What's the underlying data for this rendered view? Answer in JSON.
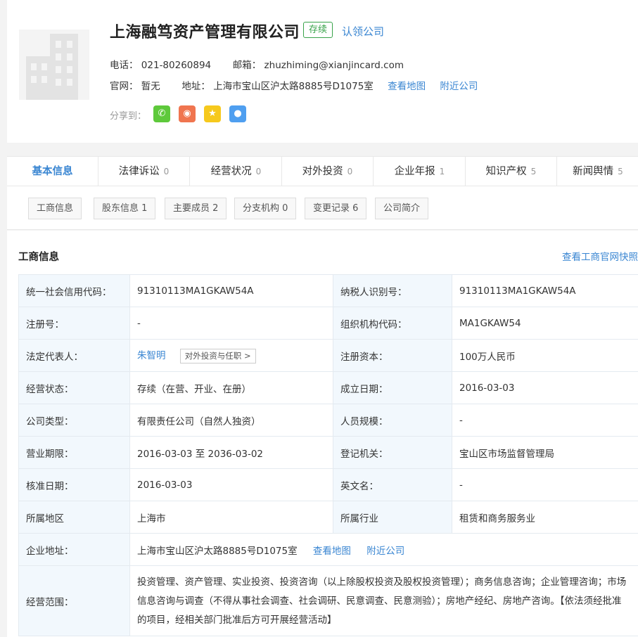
{
  "company": {
    "name": "上海融笃资产管理有限公司",
    "status": "存续",
    "claim": "认领公司",
    "phone_label": "电话：",
    "phone": "021-80260894",
    "email_label": "邮箱：",
    "email": "zhuzhiming@xianjincard.com",
    "website_label": "官网：",
    "website": "暂无",
    "address_label": "地址：",
    "address": "上海市宝山区沪太路8885号D1075室",
    "view_map": "查看地图",
    "nearby": "附近公司",
    "share_label": "分享到："
  },
  "share": [
    {
      "icon": "wechat-icon",
      "glyph": "✆",
      "color": "#5ec93b"
    },
    {
      "icon": "weibo-icon",
      "glyph": "◉",
      "color": "#f0754f"
    },
    {
      "icon": "qzone-icon",
      "glyph": "★",
      "color": "#f6c91d"
    },
    {
      "icon": "qq-icon",
      "glyph": "●",
      "color": "#4f9ff0"
    }
  ],
  "tabs": [
    {
      "label": "基本信息",
      "count": ""
    },
    {
      "label": "法律诉讼",
      "count": "0"
    },
    {
      "label": "经营状况",
      "count": "0"
    },
    {
      "label": "对外投资",
      "count": "0"
    },
    {
      "label": "企业年报",
      "count": "1"
    },
    {
      "label": "知识产权",
      "count": "5"
    },
    {
      "label": "新闻舆情",
      "count": "5"
    }
  ],
  "subtabs": [
    "工商信息",
    "股东信息 1",
    "主要成员 2",
    "分支机构 0",
    "变更记录 6",
    "公司简介"
  ],
  "section": {
    "title": "工商信息",
    "link": "查看工商官网快照"
  },
  "rows": [
    {
      "k1": "统一社会信用代码：",
      "v1": "91310113MA1GKAW54A",
      "k2": "纳税人识别号：",
      "v2": "91310113MA1GKAW54A"
    },
    {
      "k1": "注册号：",
      "v1": "-",
      "k2": "组织机构代码：",
      "v2": "MA1GKAW54"
    },
    {
      "k1": "法定代表人：",
      "v1": "朱智明",
      "k2": "注册资本：",
      "v2": "100万人民币"
    },
    {
      "k1": "经营状态：",
      "v1": "存续（在营、开业、在册）",
      "k2": "成立日期：",
      "v2": "2016-03-03"
    },
    {
      "k1": "公司类型：",
      "v1": "有限责任公司（自然人独资）",
      "k2": "人员规模：",
      "v2": "-"
    },
    {
      "k1": "营业期限：",
      "v1": "2016-03-03 至 2036-03-02",
      "k2": "登记机关：",
      "v2": "宝山区市场监督管理局"
    },
    {
      "k1": "核准日期：",
      "v1": "2016-03-03",
      "k2": "英文名：",
      "v2": "-"
    },
    {
      "k1": "所属地区",
      "v1": "上海市",
      "k2": "所属行业",
      "v2": "租赁和商务服务业"
    }
  ],
  "legal_rep_button": "对外投资与任职 >",
  "address_row": {
    "k": "企业地址：",
    "v": "上海市宝山区沪太路8885号D1075室",
    "map": "查看地图",
    "nearby": "附近公司"
  },
  "scope_row": {
    "k": "经营范围：",
    "v": "投资管理、资产管理、实业投资、投资咨询（以上除股权投资及股权投资管理）；商务信息咨询；企业管理咨询；市场信息咨询与调查（不得从事社会调查、社会调研、民意调查、民意测验）；房地产经纪、房地产咨询。【依法须经批准的项目，经相关部门批准后方可开展经营活动】"
  }
}
